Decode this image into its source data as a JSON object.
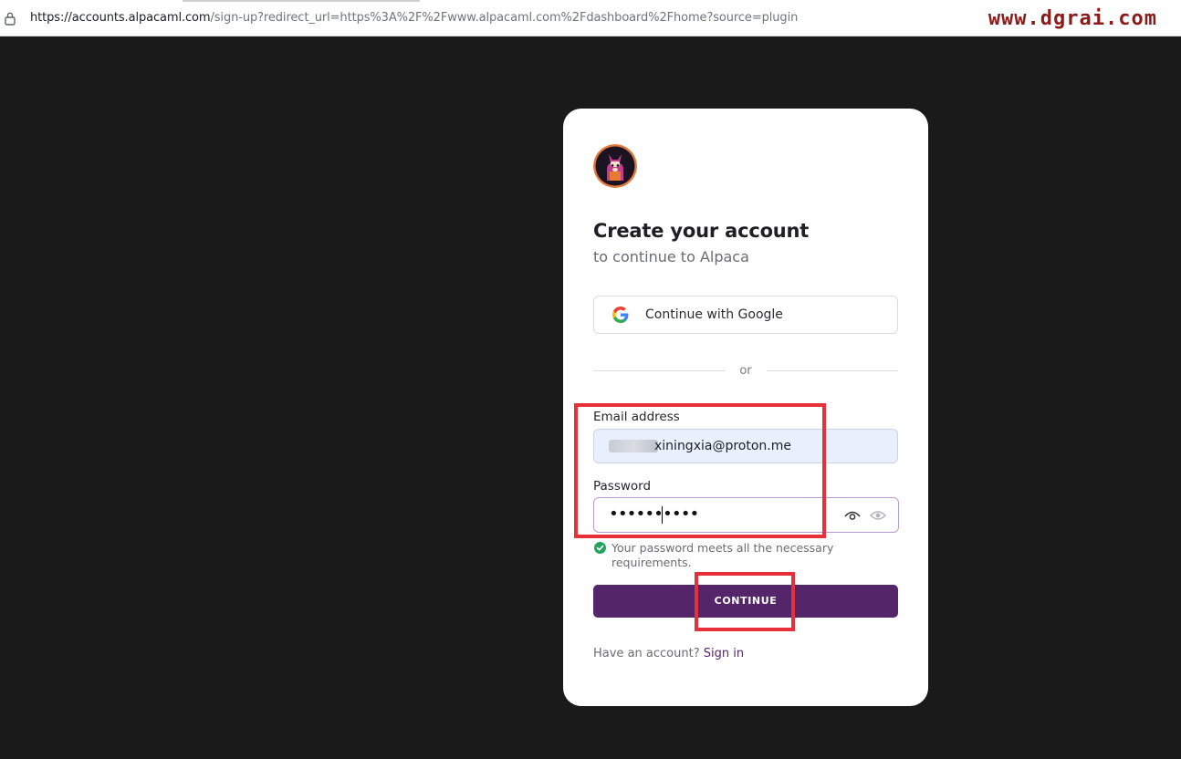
{
  "browser": {
    "url_host": "https://accounts.alpacaml.com",
    "url_rest": "/sign-up?redirect_url=https%3A%2F%2Fwww.alpacaml.com%2Fdashboard%2Fhome?source=plugin",
    "watermark": "www.dgrai.com"
  },
  "card": {
    "logo_icon": "alpaca-logo-icon",
    "title": "Create your account",
    "subtitle": "to continue to Alpaca",
    "google_button_label": "Continue with Google",
    "divider_text": "or",
    "email_label": "Email address",
    "email_value": "xiningxia@proton.me",
    "password_label": "Password",
    "password_value": "••••••••••",
    "password_hint": "Your password meets all the necessary requirements.",
    "continue_label": "CONTINUE",
    "footer_prefix": "Have an account?",
    "signin_label": "Sign in"
  },
  "colors": {
    "background": "#1a1a1a",
    "primary": "#542568",
    "highlight": "#e8303a",
    "success": "#22a45d"
  }
}
